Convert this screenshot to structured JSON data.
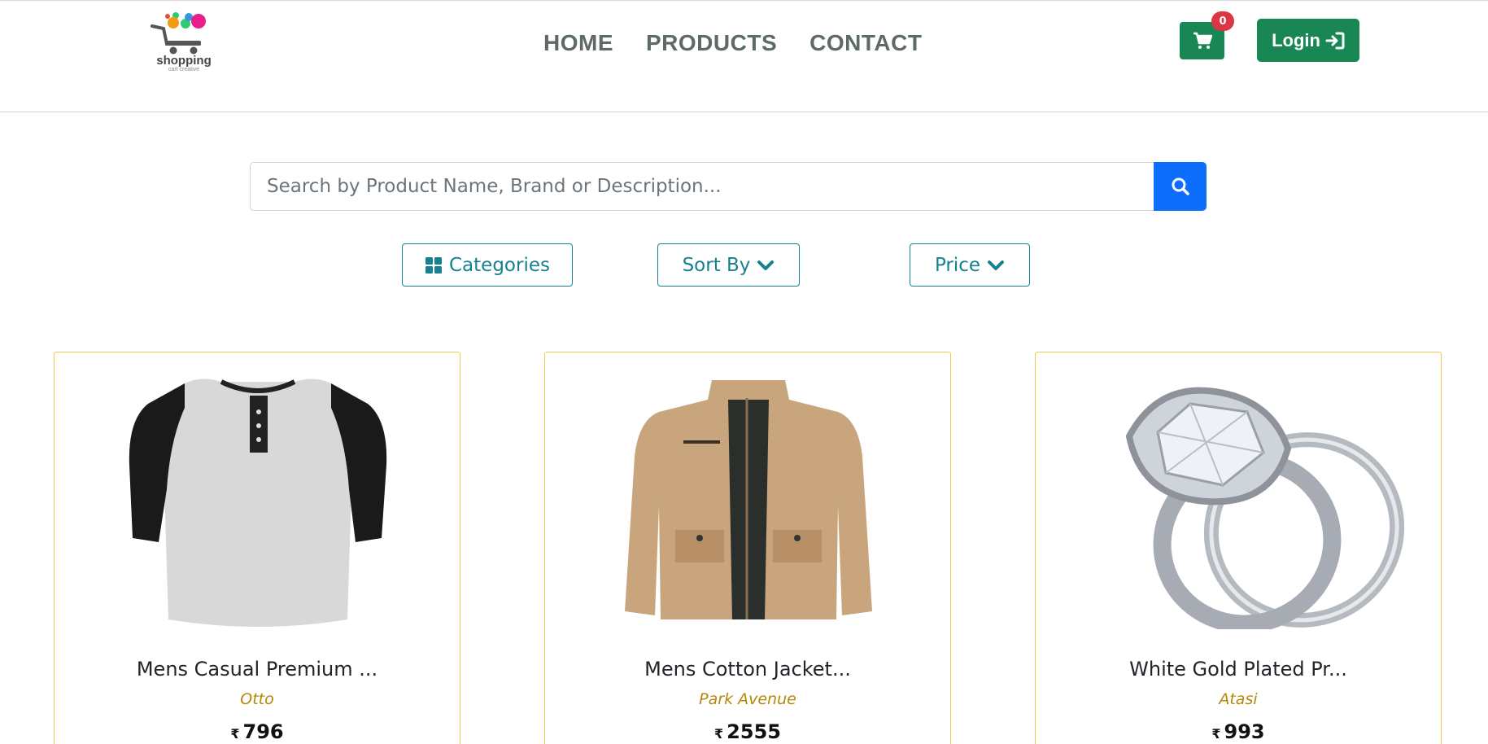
{
  "logo": {
    "text": "shopping",
    "sub": "cart creative"
  },
  "nav": {
    "home": "HOME",
    "products": "PRODUCTS",
    "contact": "CONTACT"
  },
  "cart": {
    "count": "0"
  },
  "login": {
    "label": "Login"
  },
  "search": {
    "placeholder": "Search by Product Name, Brand or Description..."
  },
  "filters": {
    "categories": "Categories",
    "sort": "Sort By",
    "price": "Price"
  },
  "products": [
    {
      "title": "Mens Casual Premium ...",
      "brand": "Otto",
      "currency": "₹",
      "price": "796"
    },
    {
      "title": "Mens Cotton Jacket...",
      "brand": "Park Avenue",
      "currency": "₹",
      "price": "2555"
    },
    {
      "title": "White Gold Plated Pr...",
      "brand": "Atasi",
      "currency": "₹",
      "price": "993"
    }
  ],
  "colors": {
    "primary": "#0d6efd",
    "success": "#198754",
    "danger": "#dc3545",
    "teal": "#17818f",
    "card_border": "#f2c94c"
  }
}
